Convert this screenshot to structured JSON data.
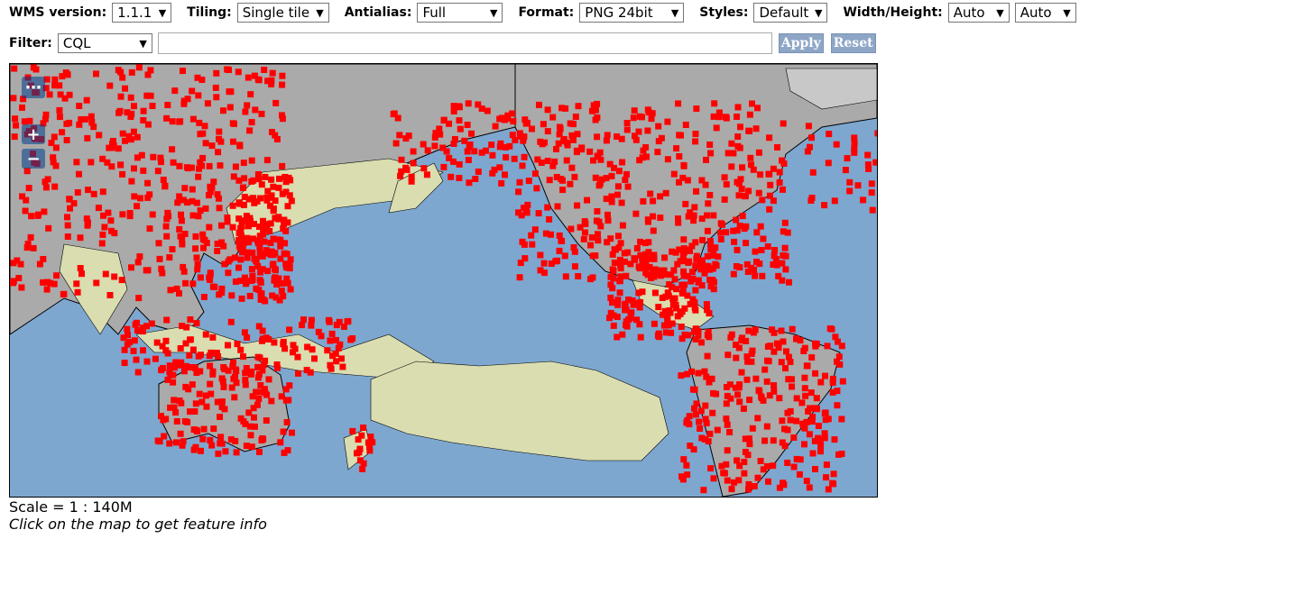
{
  "toolbar": {
    "wms_label": "WMS version:",
    "wms_value": "1.1.1",
    "tiling_label": "Tiling:",
    "tiling_value": "Single tile",
    "antialias_label": "Antialias:",
    "antialias_value": "Full",
    "format_label": "Format:",
    "format_value": "PNG 24bit",
    "styles_label": "Styles:",
    "styles_value": "Default",
    "wh_label": "Width/Height:",
    "width_value": "Auto",
    "height_value": "Auto"
  },
  "filter": {
    "label": "Filter:",
    "type_value": "CQL",
    "input_value": "",
    "apply_label": "Apply",
    "reset_label": "Reset"
  },
  "map": {
    "ocean_color": "#7ea7cf",
    "land_color": "#d9ddb0",
    "highlight_color": "#ff0000",
    "shaded_color": "#aaaaaa",
    "controls": {
      "menu_glyph": "⋯",
      "zoom_in": "+",
      "zoom_out": "−"
    }
  },
  "footer": {
    "scale": "Scale = 1 : 140M",
    "hint": "Click on the map to get feature info"
  }
}
